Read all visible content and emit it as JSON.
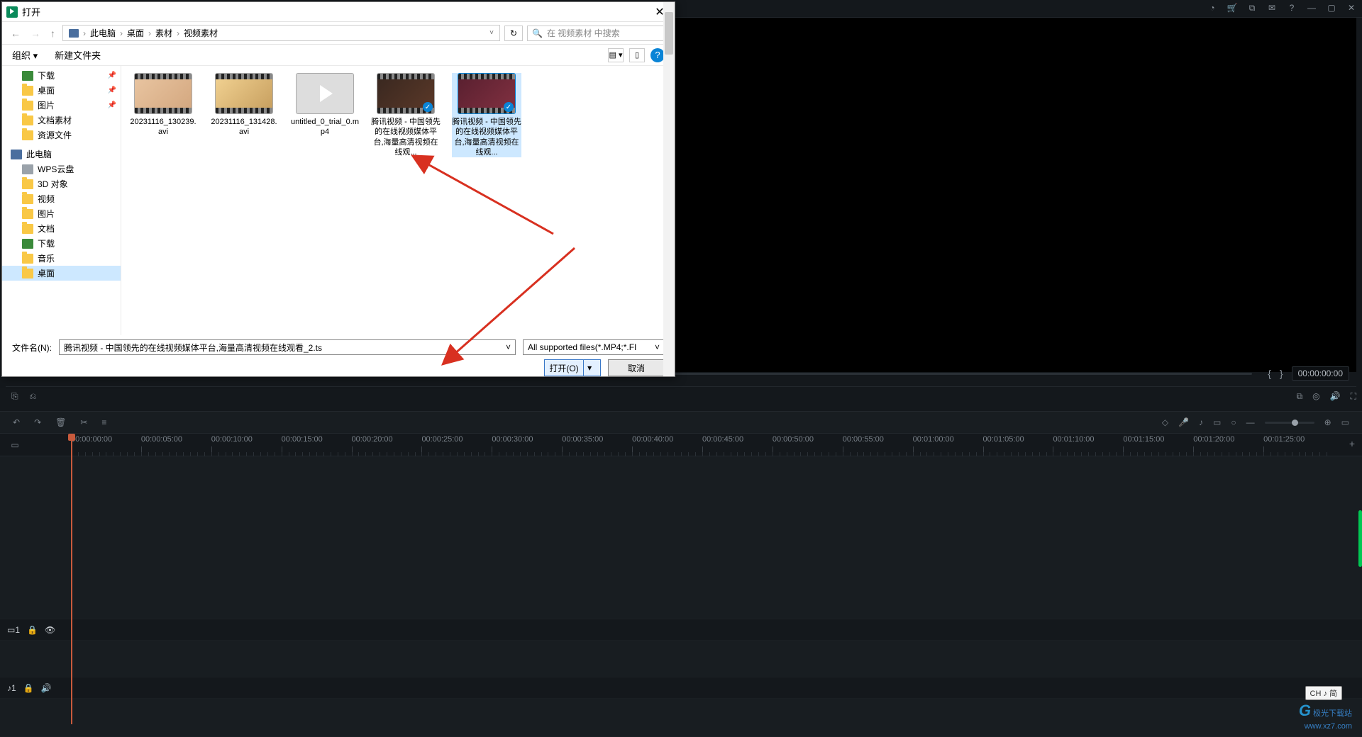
{
  "header": {
    "time": "00:00:00:00"
  },
  "preview": {
    "tc": "00:00:00:00"
  },
  "dialog": {
    "title": "打开",
    "breadcrumb": [
      "此电脑",
      "桌面",
      "素材",
      "视频素材"
    ],
    "search_placeholder": "在 视频素材 中搜索",
    "organize": "组织",
    "new_folder": "新建文件夹",
    "sidebar": {
      "quick": [
        {
          "label": "下载",
          "hasPin": true,
          "ico": "dl-ico"
        },
        {
          "label": "桌面",
          "hasPin": true,
          "ico": "folder-ico"
        },
        {
          "label": "图片",
          "hasPin": true,
          "ico": "folder-ico"
        },
        {
          "label": "文档素材",
          "hasPin": false,
          "ico": "folder-ico"
        },
        {
          "label": "资源文件",
          "hasPin": false,
          "ico": "folder-ico"
        }
      ],
      "pc_label": "此电脑",
      "pc": [
        {
          "label": "WPS云盘",
          "ico": "disk-ico"
        },
        {
          "label": "3D 对象",
          "ico": "folder-ico"
        },
        {
          "label": "视频",
          "ico": "folder-ico"
        },
        {
          "label": "图片",
          "ico": "folder-ico"
        },
        {
          "label": "文档",
          "ico": "folder-ico"
        },
        {
          "label": "下载",
          "ico": "dl-ico"
        },
        {
          "label": "音乐",
          "ico": "folder-ico"
        },
        {
          "label": "桌面",
          "ico": "folder-ico",
          "sel": true
        }
      ]
    },
    "files": [
      {
        "name": "20231116_130239.avi",
        "kind": "clip",
        "gradient": "linear-gradient(135deg,#e8c4a0,#d4a880)"
      },
      {
        "name": "20231116_131428.avi",
        "kind": "clip",
        "gradient": "linear-gradient(135deg,#f0d090,#c8a060)"
      },
      {
        "name": "untitled_0_trial_0.mp4",
        "kind": "play"
      },
      {
        "name": "腾讯视频 - 中国领先的在线视频媒体平台,海量高清视频在线观...",
        "kind": "clip",
        "badge": true,
        "gradient": "linear-gradient(135deg,#3a2820,#5a3828)"
      },
      {
        "name": "腾讯视频 - 中国领先的在线视频媒体平台,海量高清视频在线观...",
        "kind": "clip",
        "badge": true,
        "sel": true,
        "gradient": "linear-gradient(135deg,#5a2030,#803040)"
      }
    ],
    "filename_label": "文件名(N):",
    "filename": "腾讯视频 - 中国领先的在线视频媒体平台,海量高清视频在线观看_2.ts",
    "filter": "All supported files(*.MP4;*.FI",
    "open_btn": "打开(O)",
    "cancel_btn": "取消"
  },
  "ruler": {
    "marks": [
      "00:00:00:00",
      "00:00:05:00",
      "00:00:10:00",
      "00:00:15:00",
      "00:00:20:00",
      "00:00:25:00",
      "00:00:30:00",
      "00:00:35:00",
      "00:00:40:00",
      "00:00:45:00",
      "00:00:50:00",
      "00:00:55:00",
      "00:01:00:00",
      "00:01:05:00",
      "00:01:10:00",
      "00:01:15:00",
      "00:01:20:00",
      "00:01:25:00"
    ]
  },
  "ime": "CH ♪ 简",
  "watermark": {
    "brand": "极光下载站",
    "url": "www.xz7.com"
  }
}
